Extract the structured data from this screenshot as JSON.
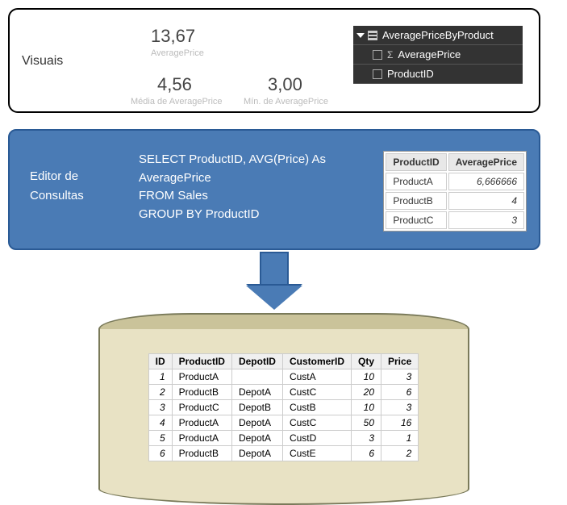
{
  "visuals": {
    "label": "Visuais",
    "metric1_value": "13,67",
    "metric1_sub": "AveragePrice",
    "metric2_value": "4,56",
    "metric2_sub": "Média de AveragePrice",
    "metric3_value": "3,00",
    "metric3_sub": "Mín. de AveragePrice"
  },
  "fields": {
    "table_name": "AveragePriceByProduct",
    "field1": "AveragePrice",
    "field2": "ProductID"
  },
  "editor": {
    "label_line1": "Editor de",
    "label_line2": "Consultas",
    "sql": "SELECT ProductID, AVG(Price) As\nAveragePrice\nFROM Sales\nGROUP BY ProductID"
  },
  "result": {
    "h1": "ProductID",
    "h2": "AveragePrice",
    "rows": [
      {
        "p": "ProductA",
        "v": "6,666666"
      },
      {
        "p": "ProductB",
        "v": "4"
      },
      {
        "p": "ProductC",
        "v": "3"
      }
    ]
  },
  "sales": {
    "headers": [
      "ID",
      "ProductID",
      "DepotID",
      "CustomerID",
      "Qty",
      "Price"
    ],
    "rows": [
      {
        "id": "1",
        "p": "ProductA",
        "d": "",
        "c": "CustA",
        "q": "10",
        "pr": "3"
      },
      {
        "id": "2",
        "p": "ProductB",
        "d": "DepotA",
        "c": "CustC",
        "q": "20",
        "pr": "6"
      },
      {
        "id": "3",
        "p": "ProductC",
        "d": "DepotB",
        "c": "CustB",
        "q": "10",
        "pr": "3"
      },
      {
        "id": "4",
        "p": "ProductA",
        "d": "DepotA",
        "c": "CustC",
        "q": "50",
        "pr": "16"
      },
      {
        "id": "5",
        "p": "ProductA",
        "d": "DepotA",
        "c": "CustD",
        "q": "3",
        "pr": "1"
      },
      {
        "id": "6",
        "p": "ProductB",
        "d": "DepotA",
        "c": "CustE",
        "q": "6",
        "pr": "2"
      }
    ]
  }
}
